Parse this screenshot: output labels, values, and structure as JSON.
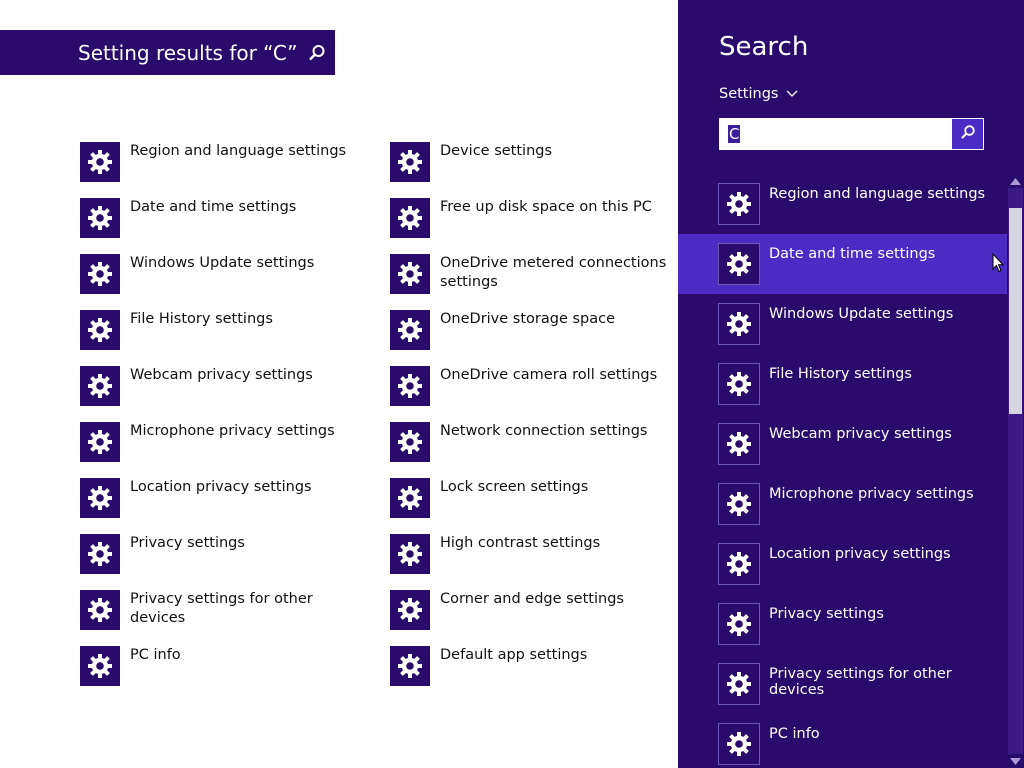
{
  "header": {
    "title": "Setting results for “C”",
    "icon": "search-icon"
  },
  "results": {
    "left": [
      "Region and language settings",
      "Date and time settings",
      "Windows Update settings",
      "File History settings",
      "Webcam privacy settings",
      "Microphone privacy settings",
      "Location privacy settings",
      "Privacy settings",
      "Privacy settings for other devices",
      "PC info"
    ],
    "right": [
      "Device settings",
      "Free up disk space on this PC",
      "OneDrive metered connections settings",
      "OneDrive storage space",
      "OneDrive camera roll settings",
      "Network connection settings",
      "Lock screen settings",
      "High contrast settings",
      "Corner and edge settings",
      "Default app settings"
    ]
  },
  "pane": {
    "title": "Search",
    "scope": "Settings",
    "query": "C",
    "items": [
      "Region and language settings",
      "Date and time settings",
      "Windows Update settings",
      "File History settings",
      "Webcam privacy settings",
      "Microphone privacy settings",
      "Location privacy settings",
      "Privacy settings",
      "Privacy settings for other devices",
      "PC info"
    ],
    "highlighted_index": 1
  },
  "colors": {
    "accent": "#2a0a6a",
    "highlight": "#4a2bc4"
  }
}
